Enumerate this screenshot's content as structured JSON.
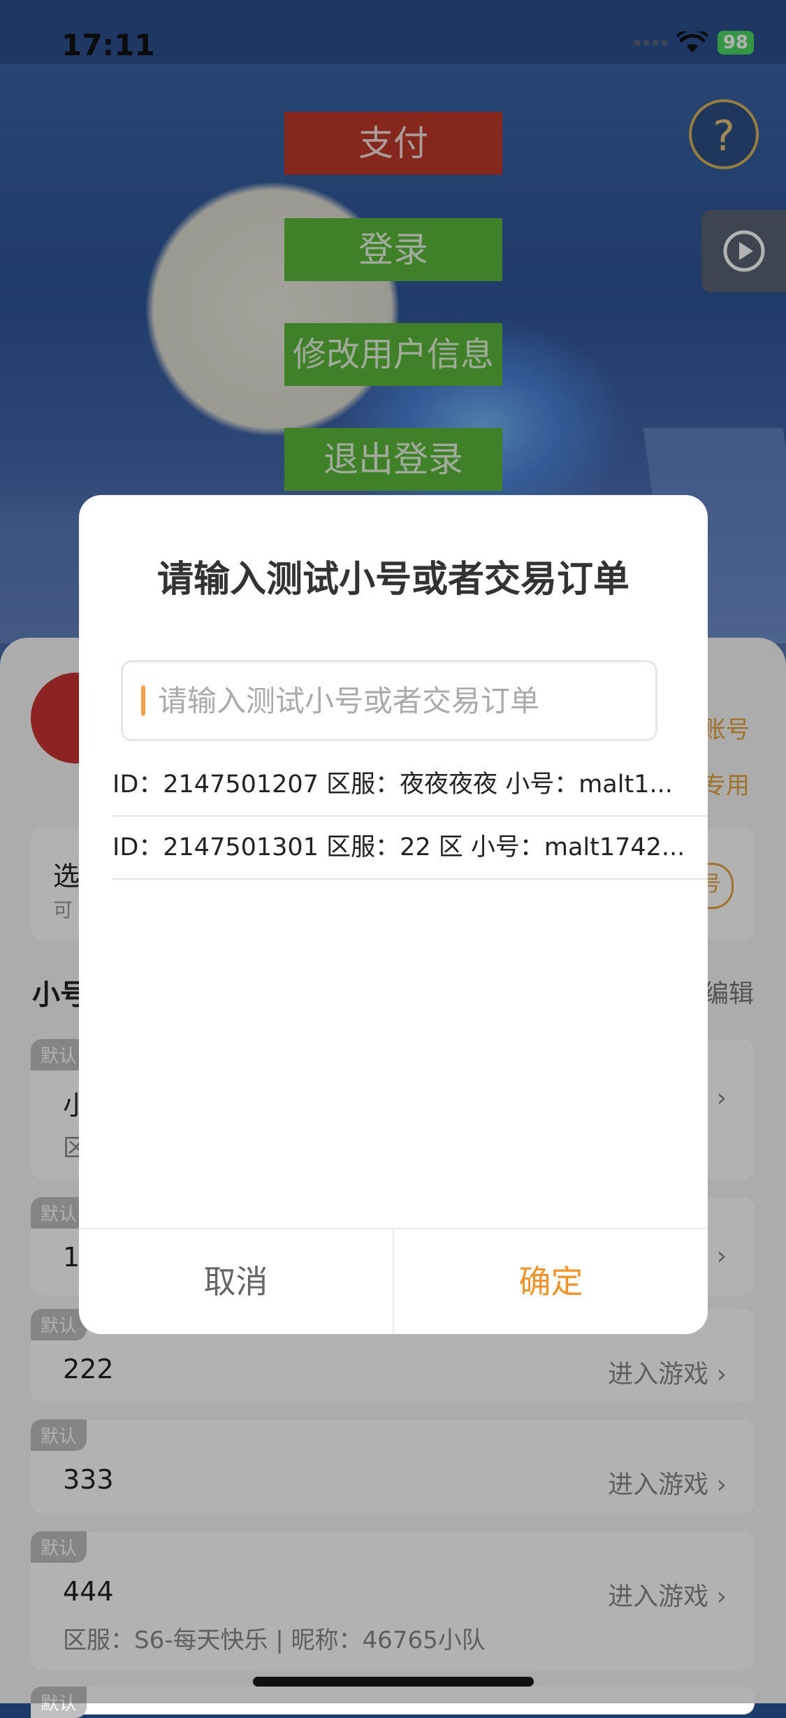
{
  "status_bar": {
    "time": "17:11",
    "battery": "98"
  },
  "game": {
    "pay_label": "支付",
    "login_label": "登录",
    "edit_user_label": "修改用户信息",
    "logout_label": "退出登录",
    "help_label": "?"
  },
  "panel": {
    "account_link_1": "账号",
    "account_link_2": "专用",
    "select_title": "选",
    "select_sub": "可",
    "select_pill": "号",
    "section_title": "小号",
    "edit_label": "编辑",
    "accounts": [
      {
        "badge": "默认",
        "name": "小",
        "enter": "",
        "detail": "区"
      },
      {
        "badge": "默认",
        "name": "11",
        "enter": "",
        "detail": ""
      },
      {
        "badge": "默认",
        "name": "222",
        "enter": "进入游戏",
        "detail": ""
      },
      {
        "badge": "默认",
        "name": "333",
        "enter": "进入游戏",
        "detail": ""
      },
      {
        "badge": "默认",
        "name": "444",
        "enter": "进入游戏",
        "detail": "区服：S6-每天快乐 | 昵称：46765小队"
      },
      {
        "badge": "默认",
        "name": "",
        "enter": "",
        "detail": ""
      }
    ]
  },
  "dialog": {
    "title": "请输入测试小号或者交易订单",
    "input_placeholder": "请输入测试小号或者交易订单",
    "input_value": "",
    "history": [
      "ID：2147501207  区服：夜夜夜夜 小号：malt1...",
      "ID：2147501301  区服：22 区 小号：malt1742..."
    ],
    "cancel_label": "取消",
    "confirm_label": "确定"
  },
  "colors": {
    "accent": "#f0932b",
    "pay": "#c0392b",
    "green": "#5cb83b"
  }
}
